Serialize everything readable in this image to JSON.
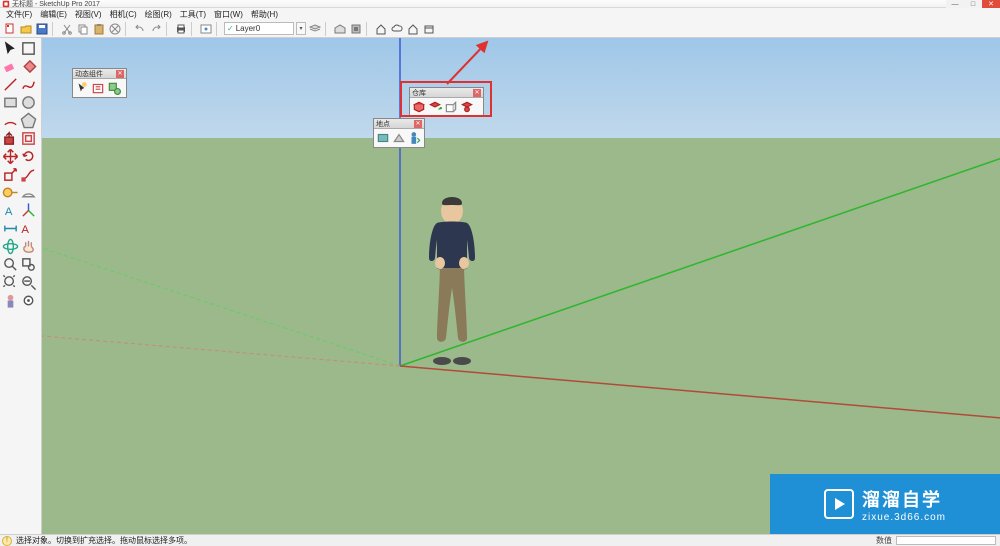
{
  "window": {
    "title": "无标题 - SketchUp Pro 2017",
    "sys": {
      "min": "—",
      "max": "□",
      "close": "✕"
    }
  },
  "menu": {
    "items": [
      "文件(F)",
      "编辑(E)",
      "视图(V)",
      "相机(C)",
      "绘图(R)",
      "工具(T)",
      "窗口(W)",
      "帮助(H)"
    ]
  },
  "toolbar": {
    "layer_label": "Layer0"
  },
  "left_toolbox": {
    "rows": [
      [
        "select-icon",
        "zoom-extents-icon"
      ],
      [
        "eraser-icon",
        "paint-bucket-icon"
      ],
      [
        "line-icon",
        "freehand-icon"
      ],
      [
        "rectangle-icon",
        "circle-icon"
      ],
      [
        "arc-icon",
        "polygon-icon"
      ],
      [
        "pushpull-icon",
        "offset-icon"
      ],
      [
        "move-icon",
        "rotate-icon"
      ],
      [
        "scale-icon",
        "followme-icon"
      ],
      [
        "tape-icon",
        "protractor-icon"
      ],
      [
        "text-icon",
        "axes-icon"
      ],
      [
        "dimension-icon",
        "3dtext-icon"
      ],
      [
        "orbit-icon",
        "pan-icon"
      ],
      [
        "zoom-icon",
        "zoomwin-icon"
      ],
      [
        "section-icon",
        "walk-icon"
      ],
      [
        "position-icon",
        "lookaround-icon"
      ]
    ]
  },
  "panels": {
    "dynamic": {
      "title": "动态组件",
      "close": "✕"
    },
    "warehouse": {
      "title": "仓库",
      "close": "✕"
    },
    "location": {
      "title": "地点",
      "close": "✕"
    }
  },
  "status": {
    "hint": "选择对象。切换到扩充选择。拖动鼠标选择多项。",
    "measure_label": "数值"
  },
  "watermark": {
    "brand": "溜溜自学",
    "url": "zixue.3d66.com"
  },
  "colors": {
    "highlight": "#e03030",
    "axis_blue": "#3a5bd8",
    "axis_green": "#2fb62f",
    "axis_red": "#c0392b"
  }
}
